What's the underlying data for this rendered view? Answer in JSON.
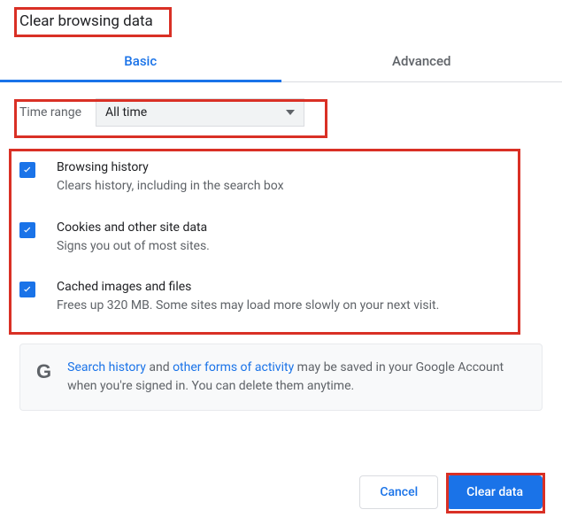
{
  "title": "Clear browsing data",
  "tabs": {
    "basic": "Basic",
    "advanced": "Advanced"
  },
  "timeRange": {
    "label": "Time range",
    "value": "All time"
  },
  "options": [
    {
      "title": "Browsing history",
      "desc": "Clears history, including in the search box",
      "checked": true
    },
    {
      "title": "Cookies and other site data",
      "desc": "Signs you out of most sites.",
      "checked": true
    },
    {
      "title": "Cached images and files",
      "desc": "Frees up 320 MB. Some sites may load more slowly on your next visit.",
      "checked": true
    }
  ],
  "info": {
    "link1": "Search history",
    "mid1": " and ",
    "link2": "other forms of activity",
    "rest": " may be saved in your Google Account when you're signed in. You can delete them anytime."
  },
  "buttons": {
    "cancel": "Cancel",
    "clear": "Clear data"
  }
}
